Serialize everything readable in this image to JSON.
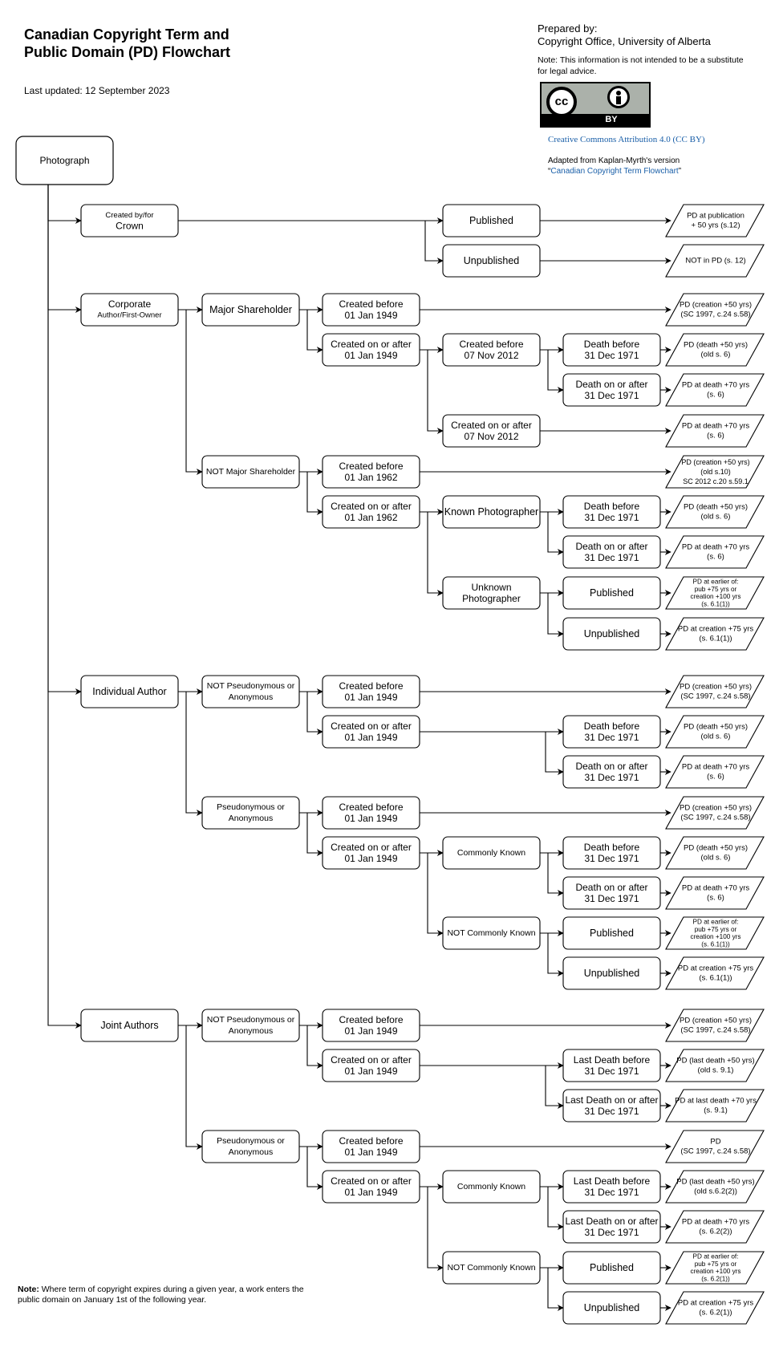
{
  "header": {
    "title": "Canadian Copyright Term and Public Domain (PD) Flowchart",
    "last_updated": "Last updated: 12 September 2023",
    "prepared_by_label": "Prepared by:",
    "prepared_by": "Copyright Office, University of Alberta",
    "disclaimer": "Note:  This information is not intended to be a substitute for legal advice.",
    "license_badge": {
      "cc": "cc",
      "by": "BY"
    },
    "license_link": "Creative Commons Attribution 4.0 (CC BY)",
    "adapted_prefix": "Adapted from Kaplan-Myrth's version",
    "adapted_link": "Canadian Copyright Term Flowchart",
    "link_color": "#1a5fa8"
  },
  "footnote": {
    "label": "Note:",
    "text": " Where term of copyright expires during a given year, a work enters the public domain on January 1st of the following year."
  },
  "flowchart": {
    "root": {
      "id": "photograph",
      "lines": [
        "Photograph"
      ]
    },
    "nodes": [
      {
        "id": "crown",
        "col": 1,
        "row": 0,
        "lines": [
          "Created by/for",
          "Crown"
        ],
        "small_first": true
      },
      {
        "id": "crown-published",
        "col": 4,
        "row": 0,
        "lines": [
          "Published"
        ]
      },
      {
        "id": "crown-unpublished",
        "col": 4,
        "row": 1,
        "lines": [
          "Unpublished"
        ]
      },
      {
        "id": "corporate",
        "col": 1,
        "row": 2,
        "lines": [
          "Corporate",
          "Author/First-Owner"
        ],
        "small_second": true
      },
      {
        "id": "major-shareholder",
        "col": 2,
        "row": 2,
        "lines": [
          "Major Shareholder"
        ]
      },
      {
        "id": "ms-before-1949",
        "col": 3,
        "row": 2,
        "lines": [
          "Created before",
          "01 Jan 1949"
        ]
      },
      {
        "id": "ms-after-1949",
        "col": 3,
        "row": 3,
        "lines": [
          "Created on or after",
          "01 Jan 1949"
        ]
      },
      {
        "id": "ms-before-2012",
        "col": 4,
        "row": 3,
        "lines": [
          "Created before",
          "07 Nov 2012"
        ]
      },
      {
        "id": "ms-death-before",
        "col": 5,
        "row": 3,
        "lines": [
          "Death before",
          "31 Dec 1971"
        ]
      },
      {
        "id": "ms-death-after",
        "col": 5,
        "row": 4,
        "lines": [
          "Death on or after",
          "31 Dec 1971"
        ]
      },
      {
        "id": "ms-after-2012",
        "col": 4,
        "row": 5,
        "lines": [
          "Created on or after",
          "07 Nov 2012"
        ]
      },
      {
        "id": "not-major-shareholder",
        "col": 2,
        "row": 6,
        "lines": [
          "NOT Major Shareholder"
        ],
        "small": true
      },
      {
        "id": "nms-before-1962",
        "col": 3,
        "row": 6,
        "lines": [
          "Created before",
          "01 Jan 1962"
        ]
      },
      {
        "id": "nms-after-1962",
        "col": 3,
        "row": 7,
        "lines": [
          "Created on or after",
          "01 Jan 1962"
        ]
      },
      {
        "id": "known-photographer",
        "col": 4,
        "row": 7,
        "lines": [
          "Known Photographer"
        ]
      },
      {
        "id": "kp-death-before",
        "col": 5,
        "row": 7,
        "lines": [
          "Death before",
          "31 Dec 1971"
        ]
      },
      {
        "id": "kp-death-after",
        "col": 5,
        "row": 8,
        "lines": [
          "Death on or after",
          "31 Dec 1971"
        ]
      },
      {
        "id": "unknown-photographer",
        "col": 4,
        "row": 9,
        "lines": [
          "Unknown",
          "Photographer"
        ]
      },
      {
        "id": "up-published",
        "col": 5,
        "row": 9,
        "lines": [
          "Published"
        ]
      },
      {
        "id": "up-unpublished",
        "col": 5,
        "row": 10,
        "lines": [
          "Unpublished"
        ]
      },
      {
        "id": "individual-author",
        "col": 1,
        "row": 11,
        "lines": [
          "Individual Author"
        ]
      },
      {
        "id": "ia-not-pseudo",
        "col": 2,
        "row": 11,
        "lines": [
          "NOT Pseudonymous or",
          "Anonymous"
        ],
        "small": true
      },
      {
        "id": "ia-np-before-1949",
        "col": 3,
        "row": 11,
        "lines": [
          "Created before",
          "01 Jan 1949"
        ]
      },
      {
        "id": "ia-np-after-1949",
        "col": 3,
        "row": 12,
        "lines": [
          "Created on or after",
          "01 Jan 1949"
        ]
      },
      {
        "id": "ia-np-death-before",
        "col": 5,
        "row": 12,
        "lines": [
          "Death before",
          "31 Dec 1971"
        ]
      },
      {
        "id": "ia-np-death-after",
        "col": 5,
        "row": 13,
        "lines": [
          "Death on or after",
          "31 Dec 1971"
        ]
      },
      {
        "id": "ia-pseudo",
        "col": 2,
        "row": 14,
        "lines": [
          "Pseudonymous or",
          "Anonymous"
        ],
        "small": true
      },
      {
        "id": "ia-p-before-1949",
        "col": 3,
        "row": 14,
        "lines": [
          "Created before",
          "01 Jan 1949"
        ]
      },
      {
        "id": "ia-p-after-1949",
        "col": 3,
        "row": 15,
        "lines": [
          "Created on or after",
          "01 Jan 1949"
        ]
      },
      {
        "id": "ia-commonly-known",
        "col": 4,
        "row": 15,
        "lines": [
          "Commonly Known"
        ],
        "small": true
      },
      {
        "id": "ia-ck-death-before",
        "col": 5,
        "row": 15,
        "lines": [
          "Death before",
          "31 Dec 1971"
        ]
      },
      {
        "id": "ia-ck-death-after",
        "col": 5,
        "row": 16,
        "lines": [
          "Death on or after",
          "31 Dec 1971"
        ]
      },
      {
        "id": "ia-not-commonly-known",
        "col": 4,
        "row": 17,
        "lines": [
          "NOT Commonly Known"
        ],
        "small": true
      },
      {
        "id": "ia-nck-published",
        "col": 5,
        "row": 17,
        "lines": [
          "Published"
        ]
      },
      {
        "id": "ia-nck-unpublished",
        "col": 5,
        "row": 18,
        "lines": [
          "Unpublished"
        ]
      },
      {
        "id": "joint-authors",
        "col": 1,
        "row": 19,
        "lines": [
          "Joint Authors"
        ]
      },
      {
        "id": "ja-not-pseudo",
        "col": 2,
        "row": 19,
        "lines": [
          "NOT Pseudonymous or",
          "Anonymous"
        ],
        "small": true
      },
      {
        "id": "ja-np-before-1949",
        "col": 3,
        "row": 19,
        "lines": [
          "Created before",
          "01 Jan 1949"
        ]
      },
      {
        "id": "ja-np-after-1949",
        "col": 3,
        "row": 20,
        "lines": [
          "Created on or after",
          "01 Jan 1949"
        ]
      },
      {
        "id": "ja-np-last-death-before",
        "col": 5,
        "row": 20,
        "lines": [
          "Last Death before",
          "31 Dec 1971"
        ]
      },
      {
        "id": "ja-np-last-death-after",
        "col": 5,
        "row": 21,
        "lines": [
          "Last Death on or after",
          "31 Dec 1971"
        ]
      },
      {
        "id": "ja-pseudo",
        "col": 2,
        "row": 22,
        "lines": [
          "Pseudonymous or",
          "Anonymous"
        ],
        "small": true
      },
      {
        "id": "ja-p-before-1949",
        "col": 3,
        "row": 22,
        "lines": [
          "Created before",
          "01 Jan 1949"
        ]
      },
      {
        "id": "ja-p-after-1949",
        "col": 3,
        "row": 23,
        "lines": [
          "Created on or after",
          "01 Jan 1949"
        ]
      },
      {
        "id": "ja-commonly-known",
        "col": 4,
        "row": 23,
        "lines": [
          "Commonly Known"
        ],
        "small": true
      },
      {
        "id": "ja-ck-last-death-before",
        "col": 5,
        "row": 23,
        "lines": [
          "Last Death before",
          "31 Dec 1971"
        ]
      },
      {
        "id": "ja-ck-last-death-after",
        "col": 5,
        "row": 24,
        "lines": [
          "Last Death on or after",
          "31 Dec 1971"
        ]
      },
      {
        "id": "ja-not-commonly-known",
        "col": 4,
        "row": 25,
        "lines": [
          "NOT Commonly Known"
        ],
        "small": true
      },
      {
        "id": "ja-nck-published",
        "col": 5,
        "row": 25,
        "lines": [
          "Published"
        ]
      },
      {
        "id": "ja-nck-unpublished",
        "col": 5,
        "row": 26,
        "lines": [
          "Unpublished"
        ]
      }
    ],
    "outcomes": [
      {
        "id": "o-crown-pub",
        "row": 0,
        "lines": [
          "PD at publication",
          "+ 50 yrs (s.12)"
        ]
      },
      {
        "id": "o-crown-unpub",
        "row": 1,
        "lines": [
          "NOT in PD (s. 12)"
        ]
      },
      {
        "id": "o-ms-before-1949",
        "row": 2,
        "lines": [
          "PD (creation +50 yrs)",
          "(SC 1997, c.24 s.58)"
        ]
      },
      {
        "id": "o-ms-death-before",
        "row": 3,
        "lines": [
          "PD (death +50 yrs)",
          "(old s. 6)"
        ]
      },
      {
        "id": "o-ms-death-after",
        "row": 4,
        "lines": [
          "PD at death +70 yrs",
          "(s. 6)"
        ]
      },
      {
        "id": "o-ms-after-2012",
        "row": 5,
        "lines": [
          "PD at death +70 yrs",
          "(s. 6)"
        ]
      },
      {
        "id": "o-nms-before-1962",
        "row": 6,
        "lines": [
          "PD (creation +50 yrs)",
          "(old s.10)",
          "SC 2012 c.20 s.59.1"
        ]
      },
      {
        "id": "o-kp-death-before",
        "row": 7,
        "lines": [
          "PD (death +50 yrs)",
          "(old s. 6)"
        ]
      },
      {
        "id": "o-kp-death-after",
        "row": 8,
        "lines": [
          "PD at death +70 yrs",
          "(s. 6)"
        ]
      },
      {
        "id": "o-up-published",
        "row": 9,
        "lines": [
          "PD at earlier of:",
          "pub +75 yrs or",
          "creation +100 yrs",
          "(s. 6.1(1))"
        ]
      },
      {
        "id": "o-up-unpublished",
        "row": 10,
        "lines": [
          "PD at creation +75 yrs",
          "(s. 6.1(1))"
        ]
      },
      {
        "id": "o-ia-np-before",
        "row": 11,
        "lines": [
          "PD (creation +50 yrs)",
          "(SC 1997, c.24 s.58)"
        ]
      },
      {
        "id": "o-ia-np-death-before",
        "row": 12,
        "lines": [
          "PD (death +50 yrs)",
          "(old s. 6)"
        ]
      },
      {
        "id": "o-ia-np-death-after",
        "row": 13,
        "lines": [
          "PD at death +70 yrs",
          "(s. 6)"
        ]
      },
      {
        "id": "o-ia-p-before",
        "row": 14,
        "lines": [
          "PD (creation +50 yrs)",
          "(SC 1997, c.24 s.58)"
        ]
      },
      {
        "id": "o-ia-ck-death-before",
        "row": 15,
        "lines": [
          "PD (death +50 yrs)",
          "(old s. 6)"
        ]
      },
      {
        "id": "o-ia-ck-death-after",
        "row": 16,
        "lines": [
          "PD at death +70 yrs",
          "(s. 6)"
        ]
      },
      {
        "id": "o-ia-nck-published",
        "row": 17,
        "lines": [
          "PD at earlier of:",
          "pub +75 yrs or",
          "creation +100 yrs",
          "(s. 6.1(1))"
        ]
      },
      {
        "id": "o-ia-nck-unpublished",
        "row": 18,
        "lines": [
          "PD at creation +75 yrs",
          "(s. 6.1(1))"
        ]
      },
      {
        "id": "o-ja-np-before",
        "row": 19,
        "lines": [
          "PD (creation +50 yrs)",
          "(SC 1997, c.24 s.58)"
        ]
      },
      {
        "id": "o-ja-np-last-death-before",
        "row": 20,
        "lines": [
          "PD (last death +50 yrs)",
          "(old s. 9.1)"
        ]
      },
      {
        "id": "o-ja-np-last-death-after",
        "row": 21,
        "lines": [
          "PD at last death +70 yrs",
          "(s. 9.1)"
        ]
      },
      {
        "id": "o-ja-p-before",
        "row": 22,
        "lines": [
          "PD",
          "(SC 1997, c.24 s.58)"
        ]
      },
      {
        "id": "o-ja-ck-last-death-before",
        "row": 23,
        "lines": [
          "PD (last death +50 yrs)",
          "(old s.6.2(2))"
        ]
      },
      {
        "id": "o-ja-ck-last-death-after",
        "row": 24,
        "lines": [
          "PD at death +70 yrs",
          "(s. 6.2(2))"
        ]
      },
      {
        "id": "o-ja-nck-published",
        "row": 25,
        "lines": [
          "PD at earlier of:",
          "pub +75 yrs or",
          "creation +100 yrs",
          "(s. 6.2(1))"
        ]
      },
      {
        "id": "o-ja-nck-unpublished",
        "row": 26,
        "lines": [
          "PD at creation +75 yrs",
          "(s. 6.2(1))"
        ]
      }
    ],
    "edges": [
      [
        "photograph",
        "crown"
      ],
      [
        "photograph",
        "corporate"
      ],
      [
        "photograph",
        "individual-author"
      ],
      [
        "photograph",
        "joint-authors"
      ],
      [
        "crown",
        "crown-published"
      ],
      [
        "crown",
        "crown-unpublished"
      ],
      [
        "crown-published",
        "o-crown-pub"
      ],
      [
        "crown-unpublished",
        "o-crown-unpub"
      ],
      [
        "corporate",
        "major-shareholder"
      ],
      [
        "corporate",
        "not-major-shareholder"
      ],
      [
        "major-shareholder",
        "ms-before-1949"
      ],
      [
        "major-shareholder",
        "ms-after-1949"
      ],
      [
        "ms-before-1949",
        "o-ms-before-1949"
      ],
      [
        "ms-after-1949",
        "ms-before-2012"
      ],
      [
        "ms-after-1949",
        "ms-after-2012"
      ],
      [
        "ms-before-2012",
        "ms-death-before"
      ],
      [
        "ms-before-2012",
        "ms-death-after"
      ],
      [
        "ms-death-before",
        "o-ms-death-before"
      ],
      [
        "ms-death-after",
        "o-ms-death-after"
      ],
      [
        "ms-after-2012",
        "o-ms-after-2012"
      ],
      [
        "not-major-shareholder",
        "nms-before-1962"
      ],
      [
        "not-major-shareholder",
        "nms-after-1962"
      ],
      [
        "nms-before-1962",
        "o-nms-before-1962"
      ],
      [
        "nms-after-1962",
        "known-photographer"
      ],
      [
        "nms-after-1962",
        "unknown-photographer"
      ],
      [
        "known-photographer",
        "kp-death-before"
      ],
      [
        "known-photographer",
        "kp-death-after"
      ],
      [
        "kp-death-before",
        "o-kp-death-before"
      ],
      [
        "kp-death-after",
        "o-kp-death-after"
      ],
      [
        "unknown-photographer",
        "up-published"
      ],
      [
        "unknown-photographer",
        "up-unpublished"
      ],
      [
        "up-published",
        "o-up-published"
      ],
      [
        "up-unpublished",
        "o-up-unpublished"
      ],
      [
        "individual-author",
        "ia-not-pseudo"
      ],
      [
        "individual-author",
        "ia-pseudo"
      ],
      [
        "ia-not-pseudo",
        "ia-np-before-1949"
      ],
      [
        "ia-not-pseudo",
        "ia-np-after-1949"
      ],
      [
        "ia-np-before-1949",
        "o-ia-np-before"
      ],
      [
        "ia-np-after-1949",
        "ia-np-death-before"
      ],
      [
        "ia-np-after-1949",
        "ia-np-death-after"
      ],
      [
        "ia-np-death-before",
        "o-ia-np-death-before"
      ],
      [
        "ia-np-death-after",
        "o-ia-np-death-after"
      ],
      [
        "ia-pseudo",
        "ia-p-before-1949"
      ],
      [
        "ia-pseudo",
        "ia-p-after-1949"
      ],
      [
        "ia-p-before-1949",
        "o-ia-p-before"
      ],
      [
        "ia-p-after-1949",
        "ia-commonly-known"
      ],
      [
        "ia-p-after-1949",
        "ia-not-commonly-known"
      ],
      [
        "ia-commonly-known",
        "ia-ck-death-before"
      ],
      [
        "ia-commonly-known",
        "ia-ck-death-after"
      ],
      [
        "ia-ck-death-before",
        "o-ia-ck-death-before"
      ],
      [
        "ia-ck-death-after",
        "o-ia-ck-death-after"
      ],
      [
        "ia-not-commonly-known",
        "ia-nck-published"
      ],
      [
        "ia-not-commonly-known",
        "ia-nck-unpublished"
      ],
      [
        "ia-nck-published",
        "o-ia-nck-published"
      ],
      [
        "ia-nck-unpublished",
        "o-ia-nck-unpublished"
      ],
      [
        "joint-authors",
        "ja-not-pseudo"
      ],
      [
        "joint-authors",
        "ja-pseudo"
      ],
      [
        "ja-not-pseudo",
        "ja-np-before-1949"
      ],
      [
        "ja-not-pseudo",
        "ja-np-after-1949"
      ],
      [
        "ja-np-before-1949",
        "o-ja-np-before"
      ],
      [
        "ja-np-after-1949",
        "ja-np-last-death-before"
      ],
      [
        "ja-np-after-1949",
        "ja-np-last-death-after"
      ],
      [
        "ja-np-last-death-before",
        "o-ja-np-last-death-before"
      ],
      [
        "ja-np-last-death-after",
        "o-ja-np-last-death-after"
      ],
      [
        "ja-pseudo",
        "ja-p-before-1949"
      ],
      [
        "ja-pseudo",
        "ja-p-after-1949"
      ],
      [
        "ja-p-before-1949",
        "o-ja-p-before"
      ],
      [
        "ja-p-after-1949",
        "ja-commonly-known"
      ],
      [
        "ja-p-after-1949",
        "ja-not-commonly-known"
      ],
      [
        "ja-commonly-known",
        "ja-ck-last-death-before"
      ],
      [
        "ja-commonly-known",
        "ja-ck-last-death-after"
      ],
      [
        "ja-ck-last-death-before",
        "o-ja-ck-last-death-before"
      ],
      [
        "ja-ck-last-death-after",
        "o-ja-ck-last-death-after"
      ],
      [
        "ja-not-commonly-known",
        "ja-nck-published"
      ],
      [
        "ja-not-commonly-known",
        "ja-nck-unpublished"
      ],
      [
        "ja-nck-published",
        "o-ja-nck-published"
      ],
      [
        "ja-nck-unpublished",
        "o-ja-nck-unpublished"
      ]
    ]
  }
}
